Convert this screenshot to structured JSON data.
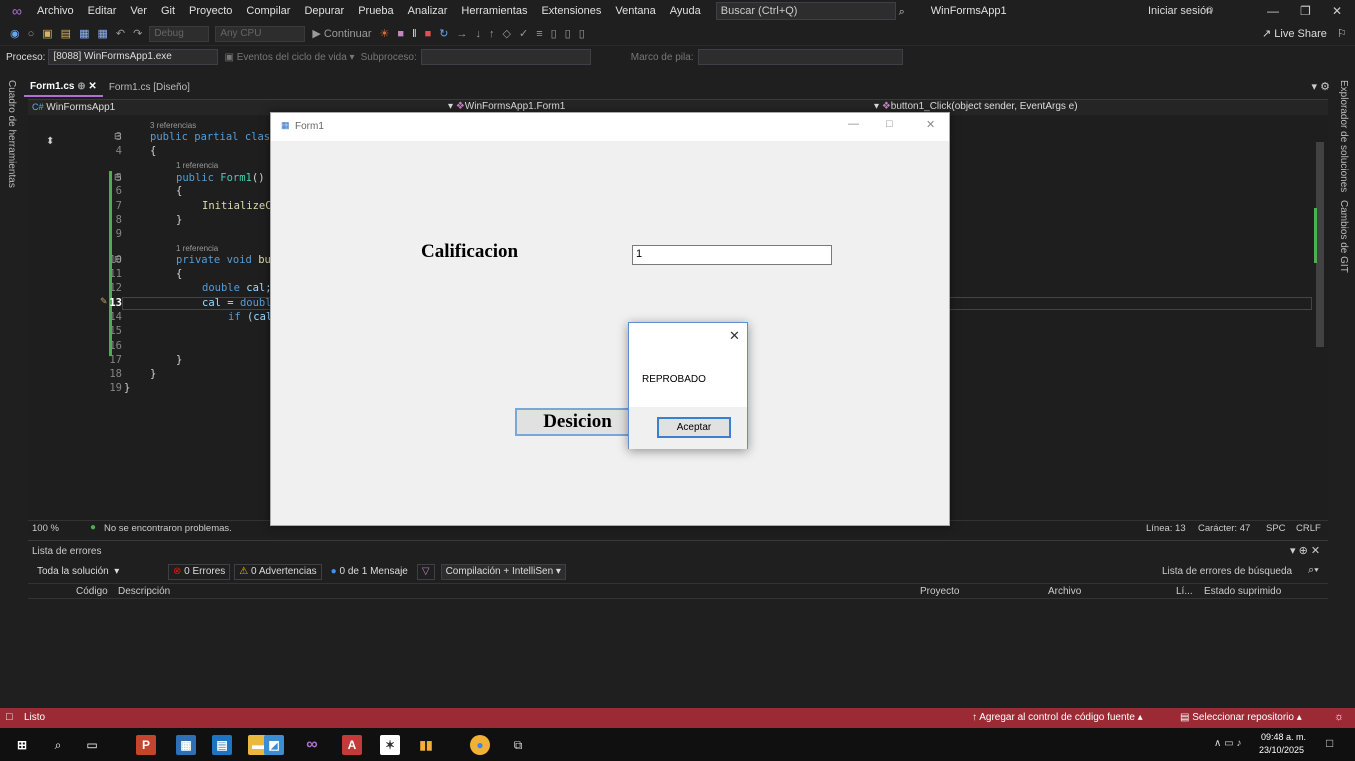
{
  "menu": [
    "Archivo",
    "Editar",
    "Ver",
    "Git",
    "Proyecto",
    "Compilar",
    "Depurar",
    "Prueba",
    "Analizar",
    "Herramientas",
    "Extensiones",
    "Ventana",
    "Ayuda"
  ],
  "search_placeholder": "Buscar (Ctrl+Q)",
  "solution_title": "WinFormsApp1",
  "signin": "Iniciar sesión",
  "liveshare": "Live Share",
  "toolbar": {
    "config": "Debug",
    "platform": "Any CPU",
    "continue": "Continuar"
  },
  "process": {
    "label": "Proceso:",
    "value": "[8088] WinFormsApp1.exe",
    "events": "Eventos del ciclo de vida",
    "thread": "Subproceso:",
    "stack": "Marco de pila:"
  },
  "left_strip": "Cuadro de herramientas",
  "right_strip": {
    "a": "Explorador de soluciones",
    "b": "Cambios de GIT"
  },
  "tabs": [
    {
      "label": "Form1.cs"
    },
    {
      "label": "Form1.cs [Diseño]"
    }
  ],
  "nav": {
    "project": "WinFormsApp1",
    "class": "WinFormsApp1.Form1",
    "member": "button1_Click(object sender, EventArgs e)"
  },
  "editor": {
    "refs": {
      "r3": "3 referencias",
      "r1a": "1 referencia",
      "r1b": "1 referencia"
    },
    "lines": [
      "3",
      "4",
      "5",
      "6",
      "7",
      "8",
      "9",
      "10",
      "11",
      "12",
      "13",
      "14",
      "15",
      "16",
      "17",
      "18",
      "19"
    ],
    "code": {
      "l3a": "public partial",
      "l3b": " clas",
      "l4": "{",
      "l5a": "public ",
      "l5b": "Form1",
      "l5c": "()",
      "l6": "{",
      "l7": "InitializeC",
      "l8": "}",
      "l10a": "private void ",
      "l10b": "bu",
      "l11": "{",
      "l12a": "double ",
      "l12b": "cal;",
      "l13a": "cal",
      "l13b": " = ",
      "l13c": "doubl",
      "l14a": "if ",
      "l14b": "(cal",
      "l17": "}",
      "l18": "}",
      "l19": "}"
    }
  },
  "editor_status": {
    "zoom": "100 %",
    "problems": "No se encontraron problemas.",
    "line": "Línea: 13",
    "col": "Carácter: 47",
    "spc": "SPC",
    "crlf": "CRLF"
  },
  "errors": {
    "title": "Lista de errores",
    "scope": "Toda la solución",
    "errors": "0 Errores",
    "warnings": "0 Advertencias",
    "messages": "0 de 1 Mensaje",
    "build": "Compilación + IntelliSen",
    "search": "Lista de errores de búsqueda",
    "cols": {
      "code": "Código",
      "desc": "Descripción",
      "project": "Proyecto",
      "file": "Archivo",
      "line": "Lí...",
      "suppressed": "Estado suprimido"
    }
  },
  "statusbar": {
    "ready": "Listo",
    "add_source": "Agregar al control de código fuente",
    "select_repo": "Seleccionar repositorio"
  },
  "form": {
    "title": "Form1",
    "label": "Calificacion",
    "input": "1",
    "button": "Desicion"
  },
  "msgbox": {
    "text": "REPROBADO",
    "ok": "Aceptar"
  },
  "taskbar": {
    "time": "09:48 a. m.",
    "date": "23/10/2025"
  },
  "colors": {
    "accent": "#b16fd6",
    "statusbar": "#9b2a35",
    "error": "#e51400",
    "warning": "#f0c000",
    "info": "#3794ff"
  }
}
